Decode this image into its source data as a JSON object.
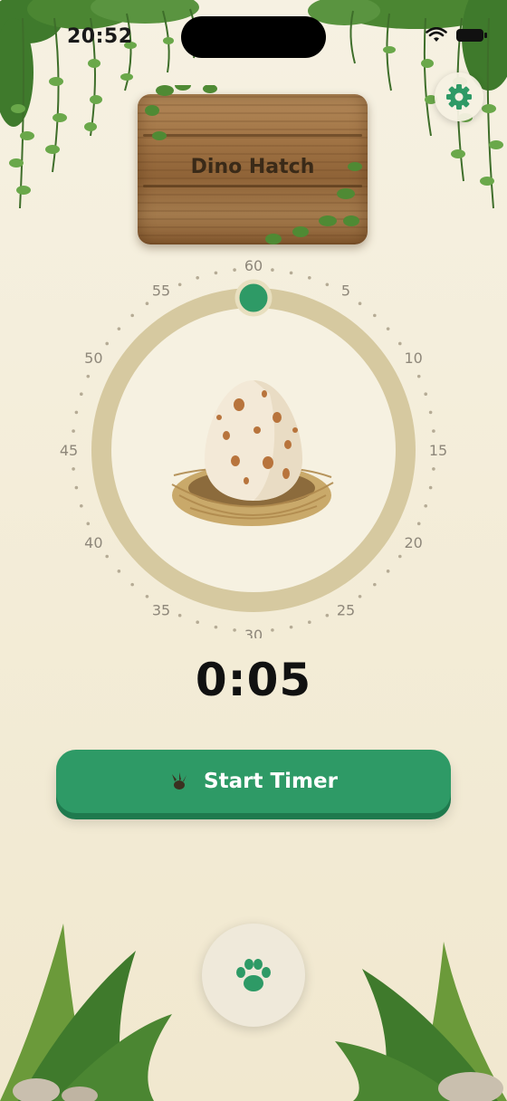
{
  "status_bar": {
    "time": "20:52"
  },
  "header": {
    "sign_title": "Dino Hatch",
    "settings_icon": "gear-icon"
  },
  "dial": {
    "labels": [
      "60",
      "5",
      "10",
      "15",
      "20",
      "25",
      "30",
      "35",
      "40",
      "45",
      "50",
      "55"
    ],
    "knob_minutes": 0,
    "center_image": "egg-in-nest"
  },
  "timer": {
    "display": "0:05"
  },
  "actions": {
    "start_label": "Start Timer",
    "start_icon": "dino-footprint-icon",
    "paw_icon": "paw-icon"
  },
  "colors": {
    "accent": "#2e9a66",
    "ring": "#d6c9a0",
    "background": "#f4eedb"
  }
}
